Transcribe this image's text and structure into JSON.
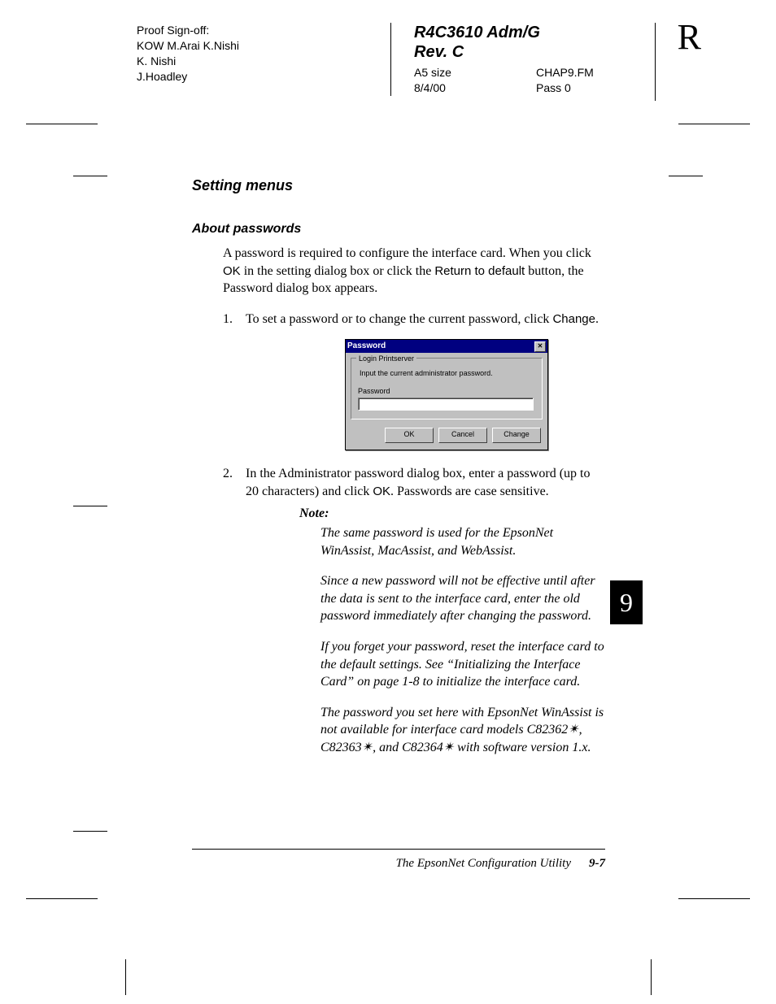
{
  "proof": {
    "label": "Proof Sign-off:",
    "line1": "KOW M.Arai  K.Nishi",
    "line2": "K. Nishi",
    "line3": "J.Hoadley"
  },
  "docMeta": {
    "title1": "R4C3610 Adm/G",
    "title2": "Rev. C",
    "size": "A5 size",
    "file": "CHAP9.FM",
    "date": "8/4/00",
    "pass": "Pass 0"
  },
  "cornerLetter": "R",
  "h1": "Setting menus",
  "h2": "About passwords",
  "intro": {
    "pre": "A password is required to configure the interface card. When you click ",
    "ok": "OK",
    "mid": " in the setting dialog box or click the ",
    "rtd": "Return to default",
    "post": " button, the Password dialog box appears."
  },
  "step1": {
    "pre": "To set a password or to change the current password, click ",
    "change": "Change",
    "post": "."
  },
  "dialog": {
    "title": "Password",
    "group": "Login Printserver",
    "instruction": "Input the current administrator password.",
    "fieldLabel": "Password",
    "ok": "OK",
    "cancel": "Cancel",
    "change": "Change"
  },
  "step2": {
    "pre": "In the Administrator password dialog box, enter a password (up to 20 characters) and click ",
    "ok": "OK",
    "post": ". Passwords are case sensitive."
  },
  "note": {
    "label": "Note:",
    "p1": "The same password is used for the EpsonNet WinAssist, MacAssist, and WebAssist.",
    "p2": "Since a new password will not be effective until after the data is sent to the interface card, enter the old password immediately after changing the password.",
    "p3": "If you forget your password, reset the interface card to the default settings. See “Initializing the Interface Card” on page 1-8 to initialize the interface card.",
    "p4": "The password you set here with EpsonNet WinAssist is not available for interface card models C82362✴, C82363✴, and C82364✴ with software version 1.x."
  },
  "chapterNum": "9",
  "footer": {
    "title": "The EpsonNet Configuration Utility",
    "page": "9-7"
  }
}
